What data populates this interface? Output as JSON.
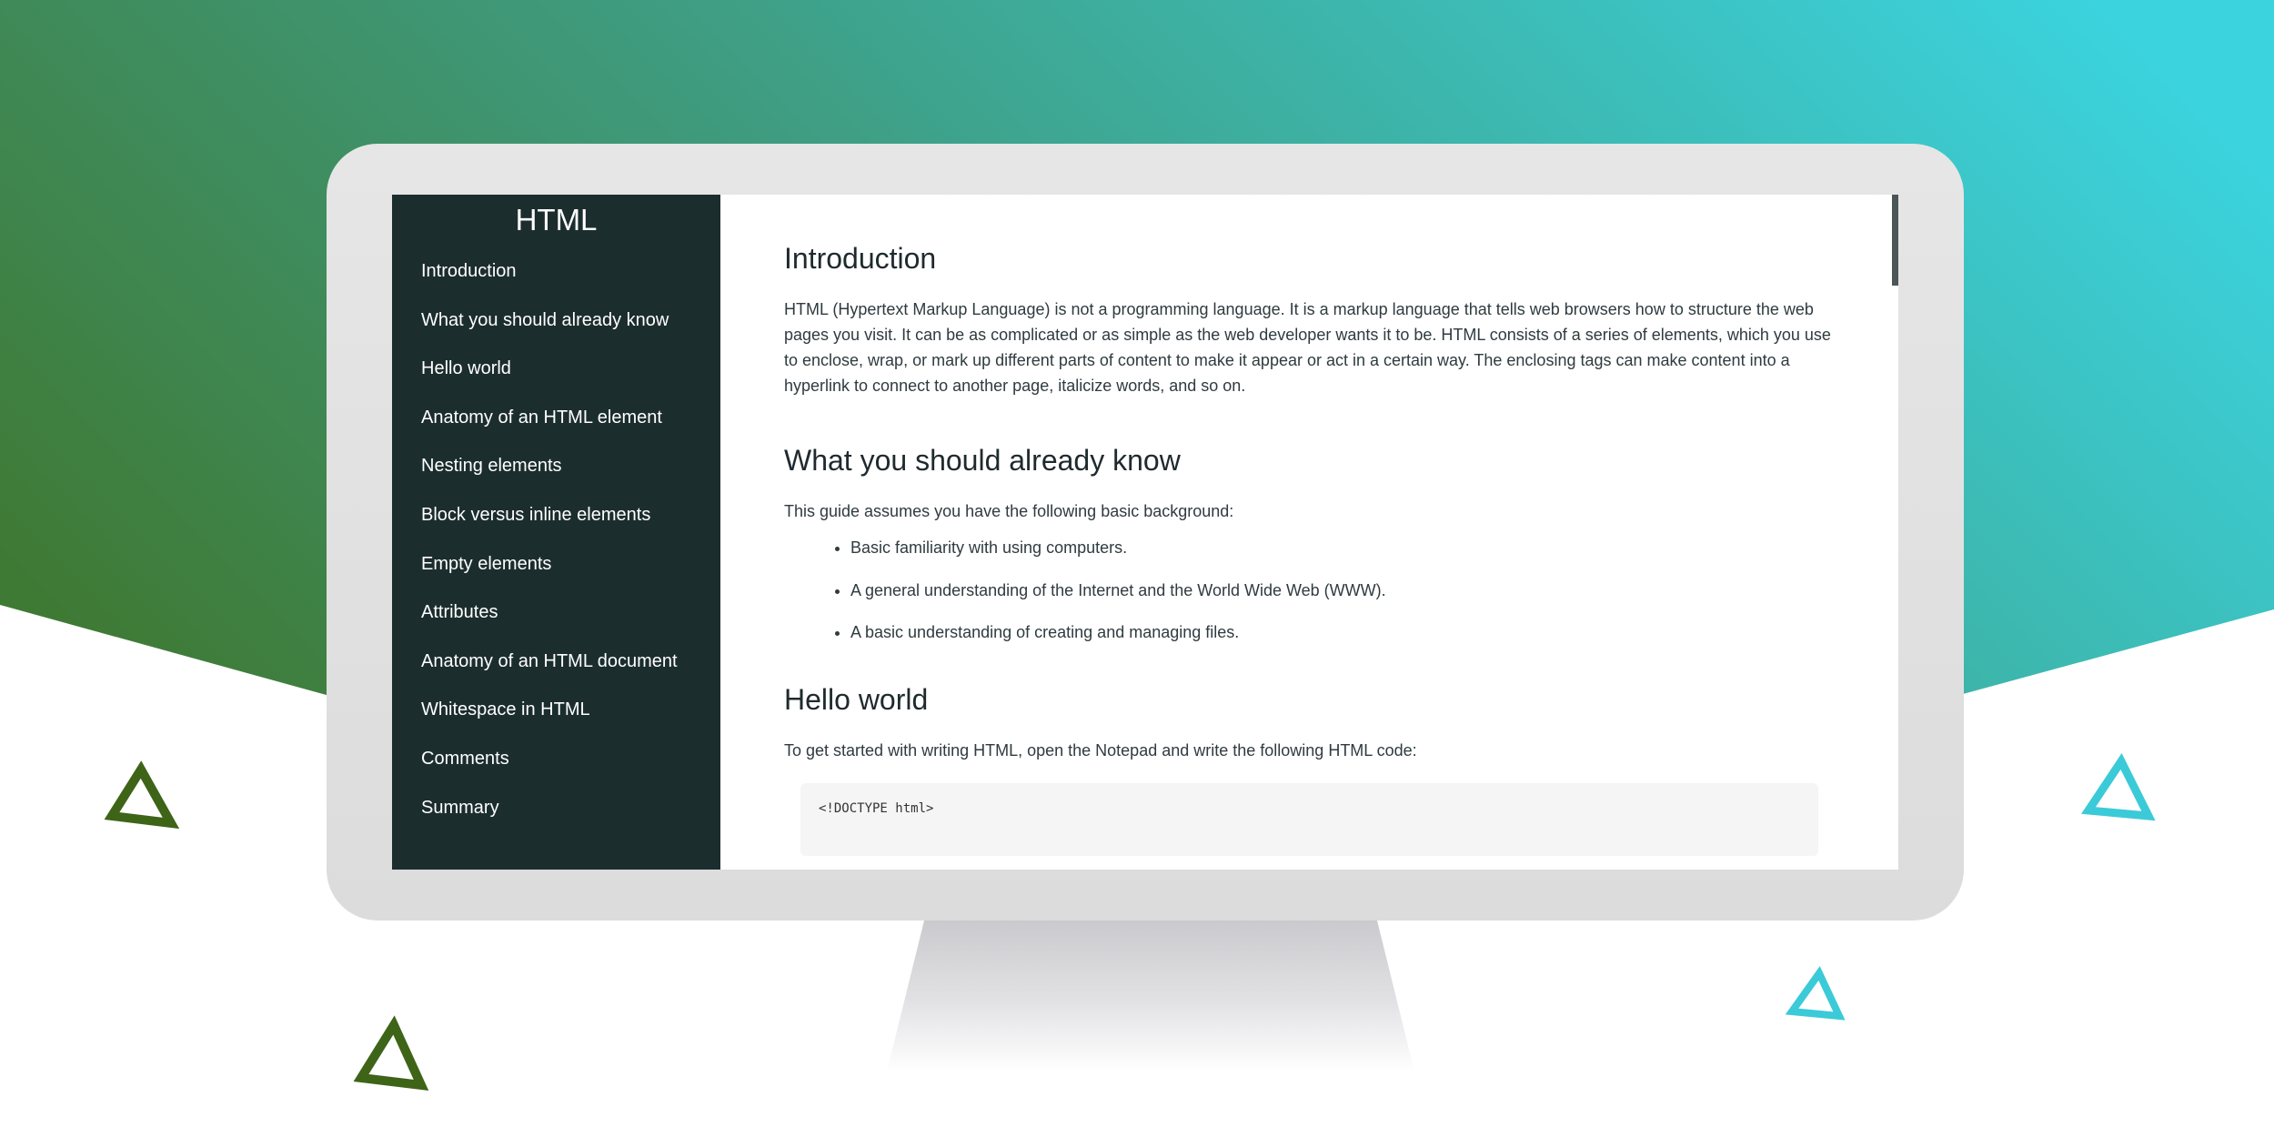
{
  "colors": {
    "bg_green": "#3d7a3a",
    "bg_teal": "#3bd2dd",
    "triangle_green": "#3e6418",
    "triangle_teal": "#3bcad8",
    "sidebar_bg": "#1c2d2e",
    "monitor_frame": "#e4e4e4"
  },
  "sidebar": {
    "title": "HTML",
    "items": [
      {
        "label": "Introduction"
      },
      {
        "label": "What you should already know"
      },
      {
        "label": "Hello world"
      },
      {
        "label": "Anatomy of an HTML element"
      },
      {
        "label": "Nesting elements"
      },
      {
        "label": "Block versus inline elements"
      },
      {
        "label": "Empty elements"
      },
      {
        "label": "Attributes"
      },
      {
        "label": "Anatomy of an HTML document"
      },
      {
        "label": "Whitespace in HTML"
      },
      {
        "label": "Comments"
      },
      {
        "label": "Summary"
      }
    ]
  },
  "main": {
    "introduction": {
      "heading": "Introduction",
      "body": "HTML (Hypertext Markup Language) is not a programming language. It is a markup language that tells web browsers how to structure the web pages you visit. It can be as complicated or as simple as the web developer wants it to be. HTML consists of a series of elements, which you use to enclose, wrap, or mark up different parts of content to make it appear or act in a certain way. The enclosing tags can make content into a hyperlink to connect to another page, italicize words, and so on."
    },
    "know": {
      "heading": "What you should already know",
      "intro": "This guide assumes you have the following basic background:",
      "bullets": [
        "Basic familiarity with using computers.",
        "A general understanding of the Internet and the World Wide Web (WWW).",
        "A basic understanding of creating and managing files."
      ]
    },
    "hello": {
      "heading": "Hello world",
      "body": "To get started with writing HTML, open the Notepad and write the following HTML code:",
      "code_first_line": "<!DOCTYPE html>"
    }
  }
}
